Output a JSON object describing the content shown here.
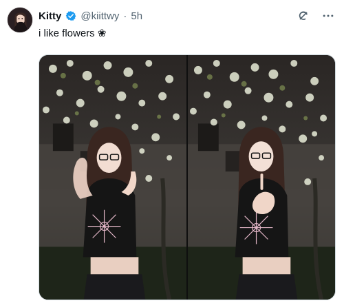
{
  "tweet": {
    "display_name": "Kitty",
    "handle": "@kiittwy",
    "separator": "·",
    "time": "5h",
    "text": "i like flowers ❀",
    "verified_color": "#1d9bf0"
  },
  "icons": {
    "verified": "verified-badge-icon",
    "grok": "grok-icon",
    "more": "more-options-icon"
  },
  "media": {
    "count": 2,
    "photos": [
      {
        "subject": "woman with glasses and flower top",
        "background": "blossoming tree at night"
      },
      {
        "subject": "woman with glasses and flower top",
        "background": "blossoming tree at night"
      }
    ]
  }
}
